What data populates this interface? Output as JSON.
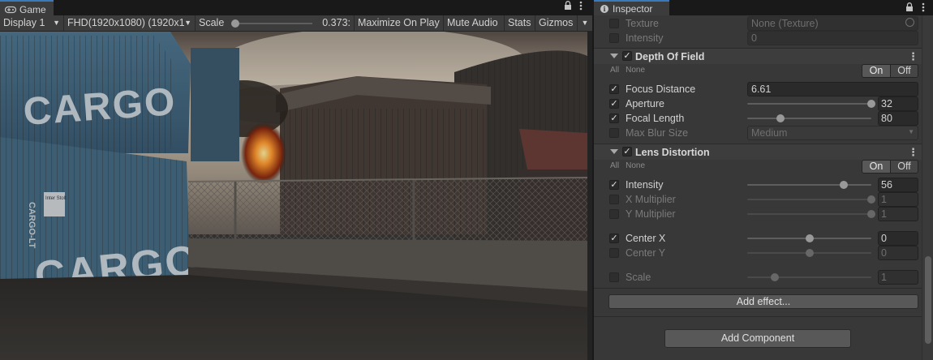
{
  "game": {
    "tab_label": "Game",
    "lock_icon": "lock-icon",
    "menu_icon": "kebab-menu-icon",
    "toolbar": {
      "display": "Display 1",
      "resolution": "FHD(1920x1080) (1920x1",
      "scale_label": "Scale",
      "scale_value": "0.373:",
      "scale_fraction": 0.0,
      "maximize": "Maximize On Play",
      "mute": "Mute Audio",
      "stats": "Stats",
      "gizmos": "Gizmos"
    },
    "scene": {
      "container_top_text": "CARGO",
      "container_bottom_text": "CARGO",
      "container_side_text": "CARGO-LT",
      "sticker_text": "Inter Stolt"
    }
  },
  "inspector": {
    "tab_label": "Inspector",
    "top_rows": [
      {
        "label": "Texture",
        "value": "None (Texture)",
        "enabled": false
      },
      {
        "label": "Intensity",
        "value": "0",
        "enabled": false
      }
    ],
    "dof": {
      "title": "Depth Of Field",
      "all": "All",
      "none": "None",
      "on": "On",
      "off": "Off",
      "focus_distance": {
        "label": "Focus Distance",
        "value": "6.61"
      },
      "aperture": {
        "label": "Aperture",
        "value": "32",
        "fraction": 1.0
      },
      "focal_length": {
        "label": "Focal Length",
        "value": "80",
        "fraction": 0.27
      },
      "max_blur": {
        "label": "Max Blur Size",
        "value": "Medium"
      }
    },
    "lens": {
      "title": "Lens Distortion",
      "all": "All",
      "none": "None",
      "on": "On",
      "off": "Off",
      "intensity": {
        "label": "Intensity",
        "value": "56",
        "fraction": 0.78
      },
      "x_mult": {
        "label": "X Multiplier",
        "value": "1",
        "fraction": 1.0
      },
      "y_mult": {
        "label": "Y Multiplier",
        "value": "1",
        "fraction": 1.0
      },
      "center_x": {
        "label": "Center X",
        "value": "0",
        "fraction": 0.5
      },
      "center_y": {
        "label": "Center Y",
        "value": "0",
        "fraction": 0.5
      },
      "scale": {
        "label": "Scale",
        "value": "1",
        "fraction": 0.22
      }
    },
    "add_effect": "Add effect...",
    "add_component": "Add Component"
  }
}
